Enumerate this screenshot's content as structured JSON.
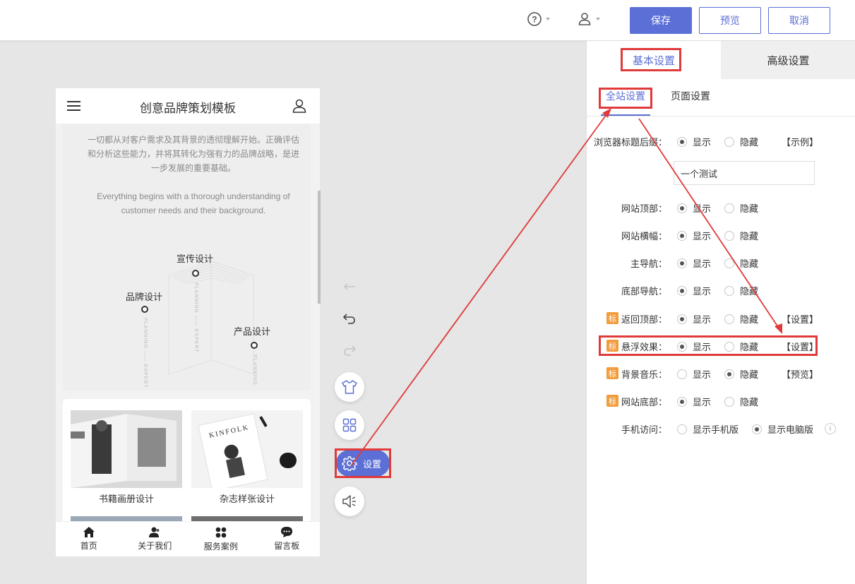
{
  "topbar": {
    "help_icon": "question-circle-icon",
    "user_icon": "user-icon",
    "save_label": "保存",
    "preview_label": "预览",
    "cancel_label": "取消"
  },
  "phone": {
    "title": "创意品牌策划模板",
    "intro_cn": "一切都从对客户需求及其背景的透彻理解开始。正确评估和分析这些能力，并将其转化为强有力的品牌战略，是进一步发展的重要基础。",
    "intro_en": "Everything begins with a thorough understanding of customer needs and their background.",
    "diagram": {
      "label_promo": "宣传设计",
      "label_brand": "品牌设计",
      "label_product": "产品设计",
      "vtext_promo": "PLANNING —— EXPERT",
      "vtext_brand": "PLANNING —— EXPERT",
      "vtext_product": "PLANNING"
    },
    "cases": [
      {
        "label": "书籍画册设计"
      },
      {
        "label": "杂志样张设计"
      }
    ],
    "magazine_logo": "KINFOLK",
    "nav": [
      {
        "label": "首页",
        "icon": "home-icon"
      },
      {
        "label": "关于我们",
        "icon": "people-icon"
      },
      {
        "label": "服务案例",
        "icon": "grid-icon"
      },
      {
        "label": "留言板",
        "icon": "chat-icon"
      }
    ]
  },
  "side_toolbar": {
    "settings_label": "设置"
  },
  "panel": {
    "tab_basic": "基本设置",
    "tab_advanced": "高级设置",
    "subtab_site": "全站设置",
    "subtab_page": "页面设置",
    "browser_title_label": "浏览器标题后缀：",
    "browser_title_value": "一个测试",
    "show": "显示",
    "hide": "隐藏",
    "tag": "标",
    "rows": [
      {
        "label": "浏览器标题后缀：",
        "selected": "show",
        "link": "【示例】"
      },
      {
        "label": "网站顶部：",
        "selected": "show",
        "link": ""
      },
      {
        "label": "网站横幅：",
        "selected": "show",
        "link": ""
      },
      {
        "label": "主导航：",
        "selected": "show",
        "link": ""
      },
      {
        "label": "底部导航：",
        "selected": "show",
        "link": ""
      },
      {
        "label": "返回顶部：",
        "selected": "show",
        "link": "【设置】",
        "tagged": true
      },
      {
        "label": "悬浮效果：",
        "selected": "show",
        "link": "【设置】",
        "tagged": true
      },
      {
        "label": "背景音乐：",
        "selected": "hide",
        "link": "【预览】",
        "tagged": true
      },
      {
        "label": "网站底部：",
        "selected": "show",
        "link": "",
        "tagged": true
      }
    ],
    "mobile_label": "手机访问：",
    "mobile_opt1": "显示手机版",
    "mobile_opt2": "显示电脑版",
    "info_icon": "i"
  },
  "colors": {
    "accent": "#5b6fd6",
    "highlight": "#e03a3a",
    "tag": "#f39c3c"
  }
}
